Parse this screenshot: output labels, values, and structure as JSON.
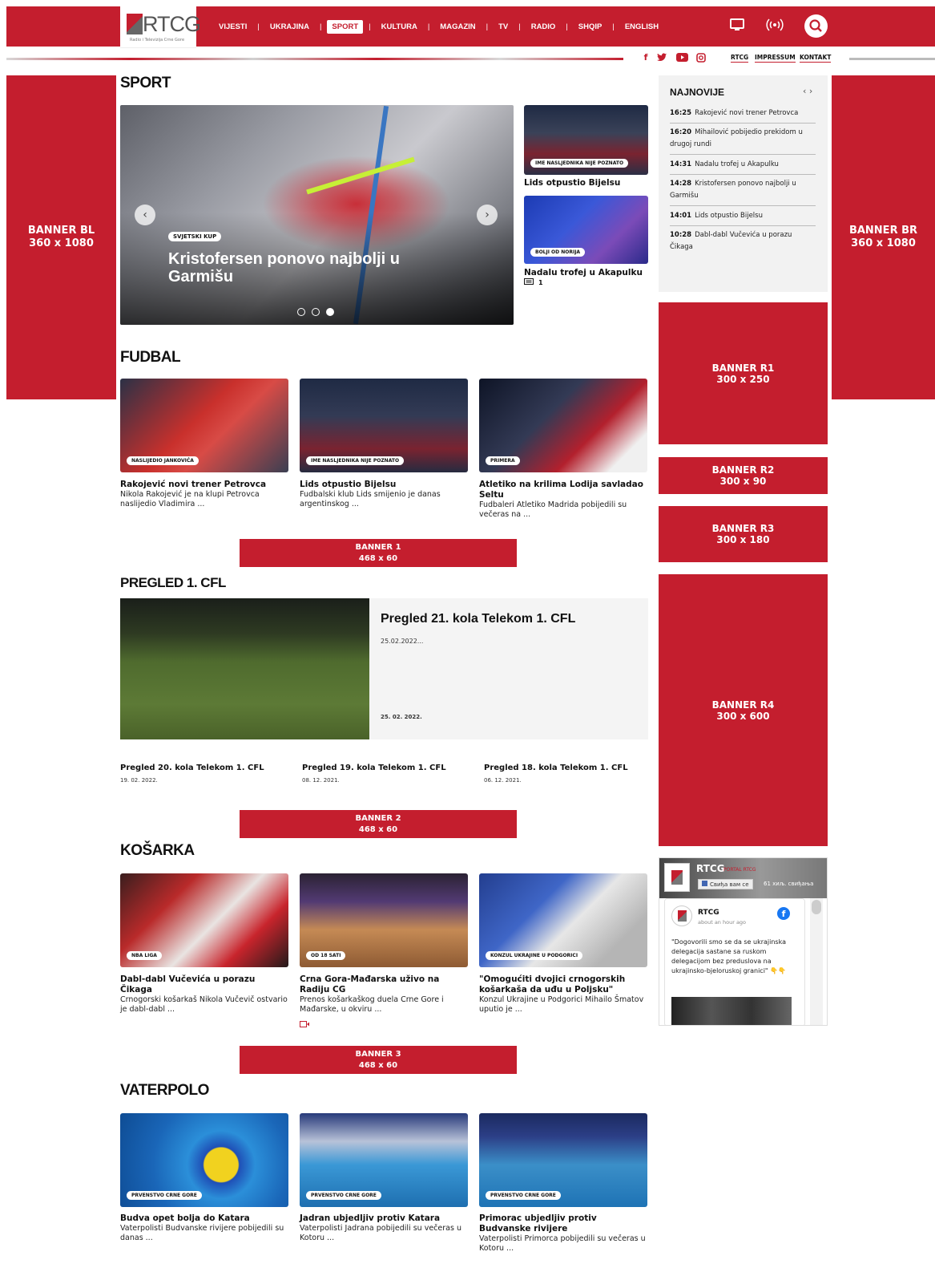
{
  "header": {
    "logo_text": "RTCG",
    "logo_sub": "Radio i Televizija Crne Gore",
    "nav": [
      "VIJESTI",
      "UKRAJINA",
      "SPORT",
      "KULTURA",
      "MAGAZIN",
      "TV",
      "RADIO",
      "SHQIP",
      "ENGLISH"
    ],
    "active_nav": "SPORT",
    "top_links": [
      "RTCG",
      "IMPRESSUM",
      "KONTAKT"
    ]
  },
  "banners": {
    "bl": [
      "BANNER BL",
      "360 x 1080"
    ],
    "br": [
      "BANNER BR",
      "360 x 1080"
    ],
    "r1": [
      "BANNER R1",
      "300 x 250"
    ],
    "r2": [
      "BANNER R2",
      "300 x 90"
    ],
    "r3": [
      "BANNER R3",
      "300 x 180"
    ],
    "r4": [
      "BANNER R4",
      "300 x 600"
    ],
    "b1": [
      "BANNER 1",
      "468 x 60"
    ],
    "b2": [
      "BANNER 2",
      "468 x 60"
    ],
    "b3": [
      "BANNER 3",
      "468 x 60"
    ]
  },
  "sport": {
    "title": "SPORT",
    "hero": {
      "tag": "SVJETSKI KUP",
      "title": "Kristofersen ponovo najbolji u Garmišu",
      "active_slide": 3,
      "slides": 3
    },
    "side": [
      {
        "tag": "IME NASLJEDNIKA NIJE POZNATO",
        "title": "Lids otpustio Bijelsu"
      },
      {
        "tag": "BOLJI OD NORIJA",
        "title": "Nadalu trofej u Akapulku",
        "comments": "1"
      }
    ]
  },
  "latest": {
    "title": "NAJNOVIJE",
    "nav": "‹ ›",
    "items": [
      {
        "time": "16:25",
        "text": "Rakojević novi trener Petrovca"
      },
      {
        "time": "16:20",
        "text": "Mihailović pobijedio prekidom u drugoj rundi"
      },
      {
        "time": "14:31",
        "text": "Nadalu trofej u Akapulku"
      },
      {
        "time": "14:28",
        "text": "Kristofersen ponovo najbolji u Garmišu"
      },
      {
        "time": "14:01",
        "text": "Lids otpustio Bijelsu"
      },
      {
        "time": "10:28",
        "text": "Dabl-dabl Vučevića u porazu Čikaga"
      }
    ]
  },
  "fudbal": {
    "title": "FUDBAL",
    "cards": [
      {
        "tag": "NASLIJEDIO JANKOVIĆA",
        "title": "Rakojević novi trener Petrovca",
        "text": "Nikola Rakojević je na klupi Petrovca naslijedio Vladimira ..."
      },
      {
        "tag": "IME NASLJEDNIKA NIJE POZNATO",
        "title": "Lids otpustio Bijelsu",
        "text": "Fudbalski klub Lids smijenio je danas argentinskog ..."
      },
      {
        "tag": "PRIMERA",
        "title": "Atletiko na krilima Lodija savladao Seltu",
        "text": "Fudbaleri Atletiko Madrida pobijedili su večeras na ..."
      }
    ]
  },
  "cfl": {
    "title": "PREGLED 1. CFL",
    "main": {
      "title": "Pregled 21. kola Telekom 1. CFL",
      "date_top": "25.02.2022...",
      "date_bottom": "25. 02. 2022."
    },
    "items": [
      {
        "title": "Pregled 20. kola Telekom 1. CFL",
        "date": "19. 02. 2022."
      },
      {
        "title": "Pregled 19. kola Telekom 1. CFL",
        "date": "08. 12. 2021."
      },
      {
        "title": "Pregled 18. kola Telekom 1. CFL",
        "date": "06. 12. 2021."
      }
    ]
  },
  "kosarka": {
    "title": "KOŠARKA",
    "cards": [
      {
        "tag": "NBA LIGA",
        "title": "Dabl-dabl Vučevića u porazu Čikaga",
        "text": "Crnogorski košarkaš Nikola Vučevič ostvario je dabl-dabl ..."
      },
      {
        "tag": "OD 18 SATI",
        "title": "Crna Gora-Mađarska uživo na Radiju CG",
        "text": "Prenos košarkaškog duela Crne Gore i Mađarske, u okviru ..."
      },
      {
        "tag": "KONZUL UKRAJINE U PODGORICI",
        "title": "\"Omogućiti dvojici crnogorskih košarkaša da uđu u Poljsku\"",
        "text": "Konzul Ukrajine u Podgorici Mihailo Šmatov uputio je ..."
      }
    ]
  },
  "vaterpolo": {
    "title": "VATERPOLO",
    "cards": [
      {
        "tag": "PRVENSTVO CRNE GORE",
        "title": "Budva opet bolja do Katara",
        "text": "Vaterpolisti Budvanske rivijere pobijedili su danas ..."
      },
      {
        "tag": "PRVENSTVO CRNE GORE",
        "title": "Jadran ubjedljiv protiv Katara",
        "text": "Vaterpolisti Jadrana pobijedili su večeras u Kotoru ..."
      },
      {
        "tag": "PRVENSTVO CRNE GORE",
        "title": "Primorac ubjedljiv protiv Budvanske rivijere",
        "text": "Vaterpolisti Primorca pobijedili su večeras u Kotoru ..."
      }
    ]
  },
  "facebook": {
    "page_name": "RTCG",
    "page_sub": "PORTAL RTCG",
    "like_label": "Свиђа вам се",
    "likes": "61 хиљ. свиђања",
    "post_author": "RTCG",
    "post_time": "about an hour ago",
    "post_text": "\"Dogovorili smo se da se ukrajinska delegacija sastane sa ruskom delegacijom bez preduslova na ukrajinsko-bjeloruskoj granici\" 👇👇"
  },
  "colors": {
    "brand": "#c41e2e"
  }
}
